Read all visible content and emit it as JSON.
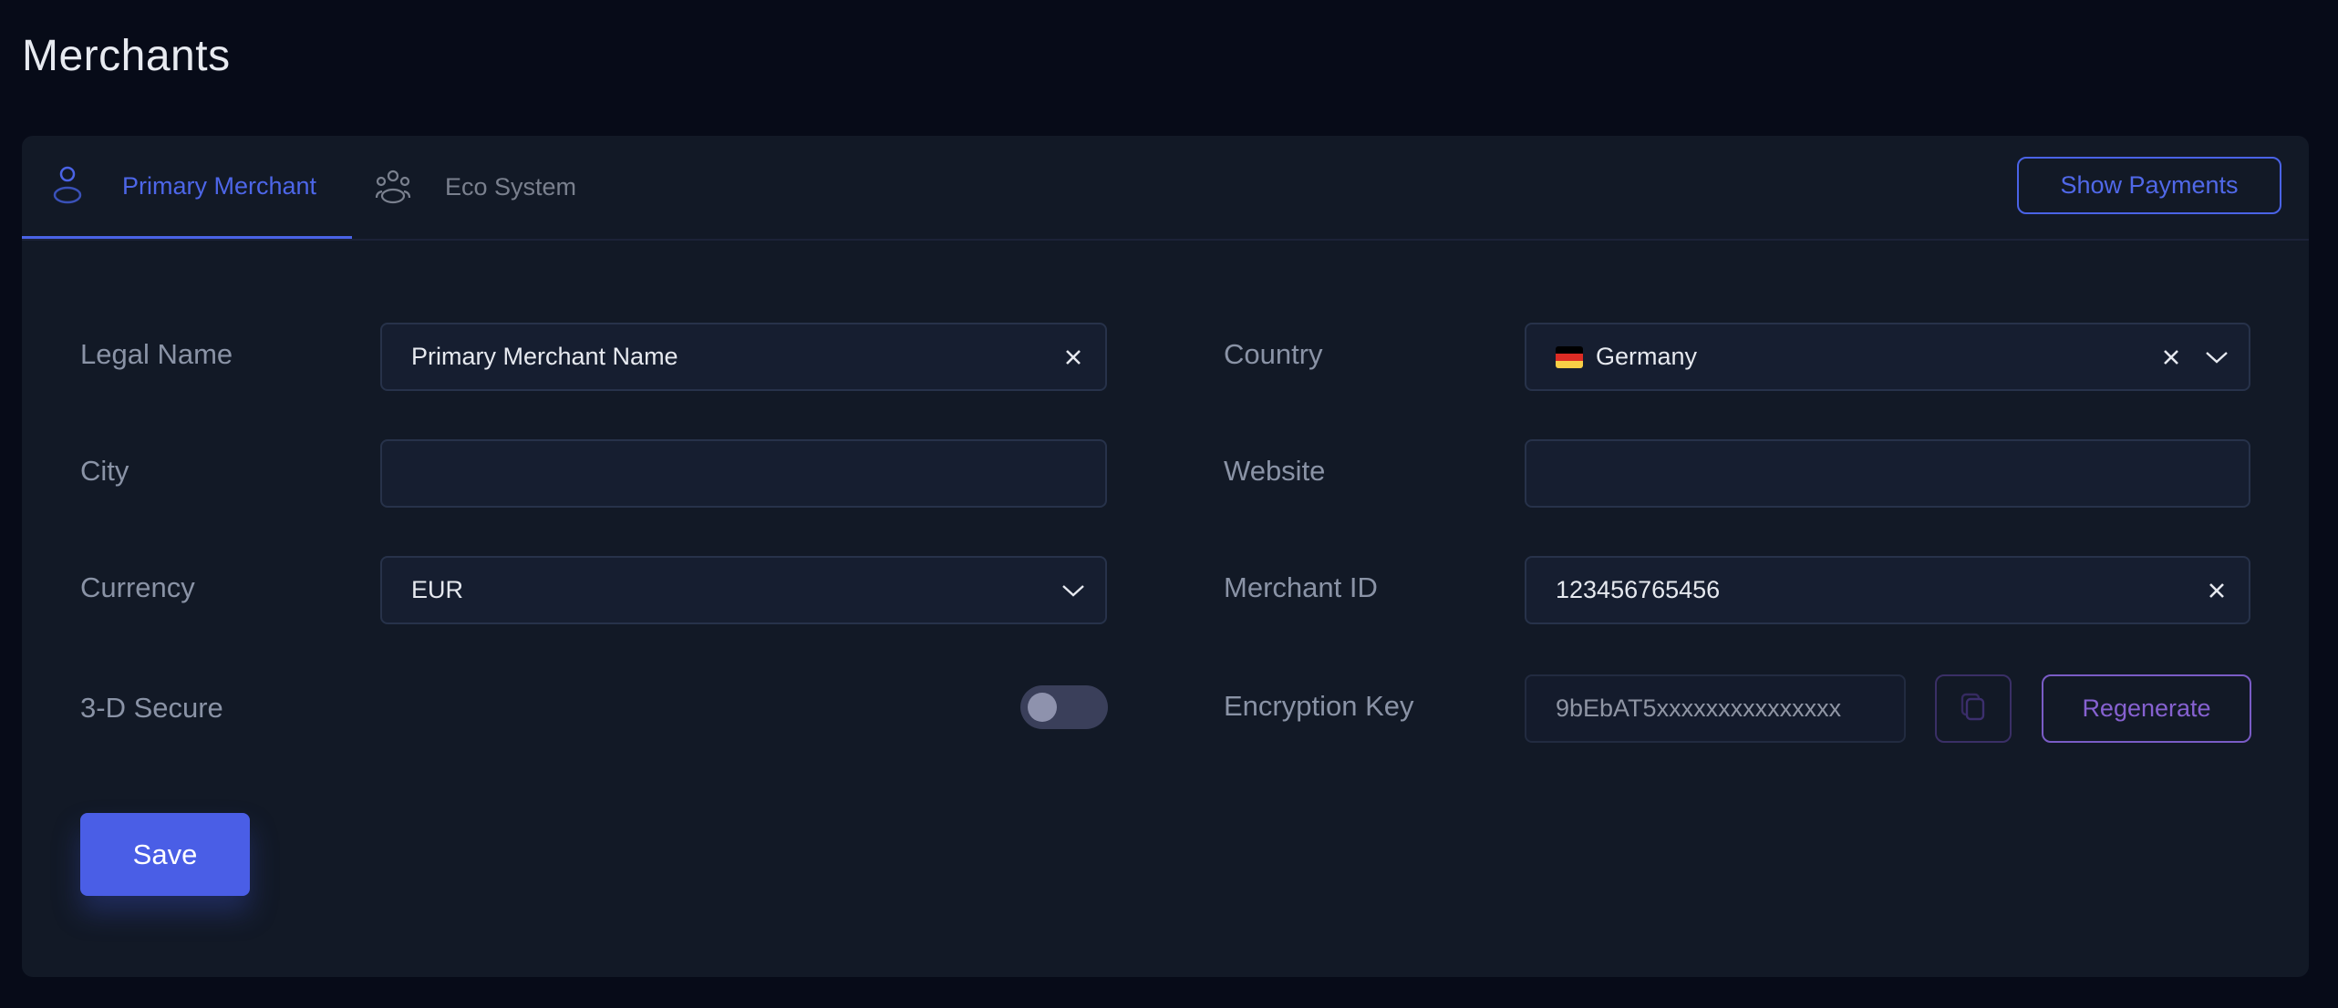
{
  "page": {
    "title": "Merchants"
  },
  "tabs": [
    {
      "label": "Primary Merchant",
      "icon": "user-icon",
      "active": true
    },
    {
      "label": "Eco System",
      "icon": "users-group-icon",
      "active": false
    }
  ],
  "header_actions": {
    "show_payments_label": "Show Payments"
  },
  "form": {
    "legal_name": {
      "label": "Legal Name",
      "value": "Primary Merchant Name",
      "placeholder": ""
    },
    "city": {
      "label": "City",
      "value": "",
      "placeholder": ""
    },
    "currency": {
      "label": "Currency",
      "selected": "EUR"
    },
    "three_d_secure": {
      "label": "3-D Secure",
      "enabled": false
    },
    "country": {
      "label": "Country",
      "selected": "Germany",
      "flag_colors": [
        "#000000",
        "#dd2c24",
        "#f8cf46"
      ]
    },
    "website": {
      "label": "Website",
      "value": "",
      "placeholder": ""
    },
    "merchant_id": {
      "label": "Merchant ID",
      "value": "123456765456"
    },
    "encryption_key": {
      "label": "Encryption Key",
      "value": "9bEbAT5xxxxxxxxxxxxxxx",
      "regenerate_label": "Regenerate"
    }
  },
  "actions": {
    "save_label": "Save"
  },
  "colors": {
    "accent": "#4a5ee6",
    "purple_accent": "#7a5cc6",
    "background": "#070b18",
    "card": "#121926"
  }
}
